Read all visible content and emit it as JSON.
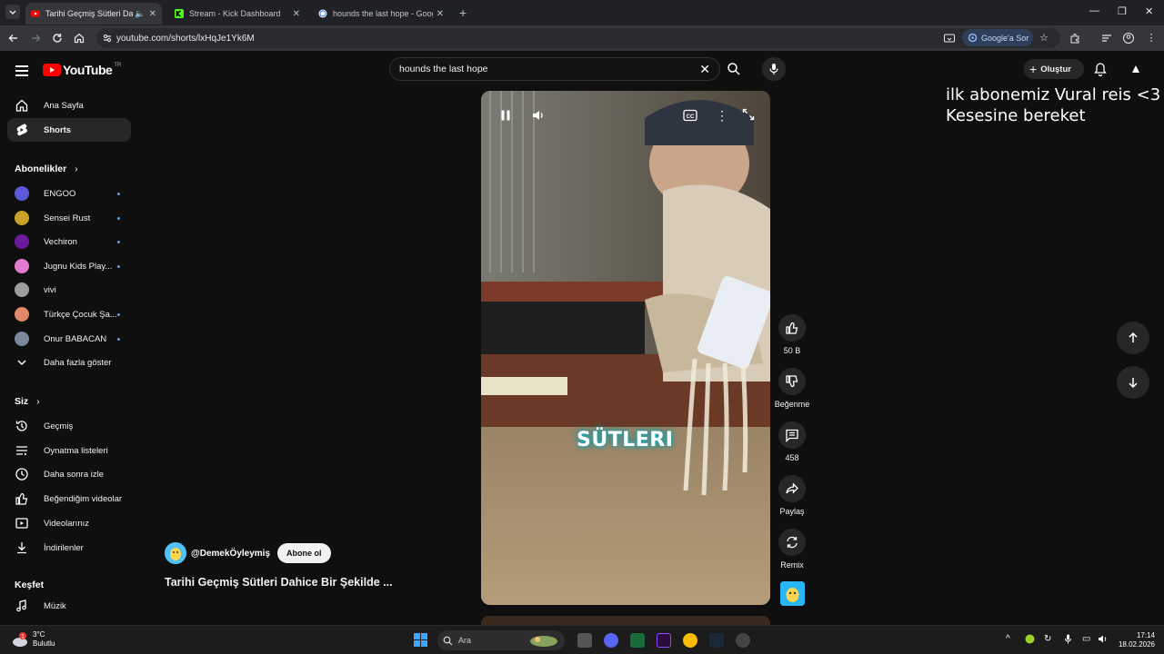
{
  "browser": {
    "tabs": [
      {
        "label": "Tarihi Geçmiş Sütleri Dahice",
        "active": true,
        "favicon": "youtube-icon"
      },
      {
        "label": "Stream - Kick Dashboard",
        "active": false,
        "favicon": "kick-icon"
      },
      {
        "label": "hounds the last hope - Google",
        "active": false,
        "favicon": "google-icon"
      }
    ],
    "url": "youtube.com/shorts/lxHqJe1Yk6M",
    "google_lens_label": "Google'a Sor"
  },
  "youtube": {
    "logo_text": "YouTube",
    "logo_region": "TR",
    "search_value": "hounds the last hope",
    "create_label": "Oluştur",
    "sidebar": {
      "main": [
        {
          "label": "Ana Sayfa",
          "icon": "home-icon"
        },
        {
          "label": "Shorts",
          "icon": "shorts-icon",
          "active": true
        }
      ],
      "subscriptions_title": "Abonelikler",
      "subscriptions": [
        {
          "label": "ENGOO",
          "color": "#5a5ad8"
        },
        {
          "label": "Sensei Rust",
          "color": "#c9a227"
        },
        {
          "label": "Vechiron",
          "color": "#6a1b9a"
        },
        {
          "label": "Jugnu Kids Play...",
          "color": "#e57bd0"
        },
        {
          "label": "vivi",
          "color": "#9e9e9e"
        },
        {
          "label": "Türkçe Çocuk Şa...",
          "color": "#e0886a"
        },
        {
          "label": "Onur BABACAN",
          "color": "#7a8a9a"
        }
      ],
      "show_more": "Daha fazla göster",
      "you_title": "Siz",
      "you": [
        {
          "label": "Geçmiş",
          "icon": "history-icon"
        },
        {
          "label": "Oynatma listeleri",
          "icon": "playlist-icon"
        },
        {
          "label": "Daha sonra izle",
          "icon": "clock-icon"
        },
        {
          "label": "Beğendiğim videolar",
          "icon": "like-icon"
        },
        {
          "label": "Videolarınız",
          "icon": "video-icon"
        },
        {
          "label": "İndirilenler",
          "icon": "download-icon"
        }
      ],
      "explore_title": "Keşfet",
      "explore": [
        {
          "label": "Müzik",
          "icon": "music-icon"
        }
      ]
    },
    "short": {
      "caption": "SÜTLERI",
      "channel": "@DemekÖyleymiş",
      "subscribe_label": "Abone ol",
      "title": "Tarihi Geçmiş Sütleri Dahice Bir Şekilde ...",
      "likes": "50 B",
      "dislike_label": "Beğenme",
      "comments": "458",
      "share_label": "Paylaş",
      "remix_label": "Remix"
    }
  },
  "overlay": {
    "line1": "ilk abonemiz Vural reis <3",
    "line2": "Kesesine bereket"
  },
  "taskbar": {
    "weather_temp": "3°C",
    "weather_desc": "Bulutlu",
    "weather_badge": "1",
    "search_placeholder": "Ara",
    "time": "17:14",
    "date": "18.02.2026"
  }
}
